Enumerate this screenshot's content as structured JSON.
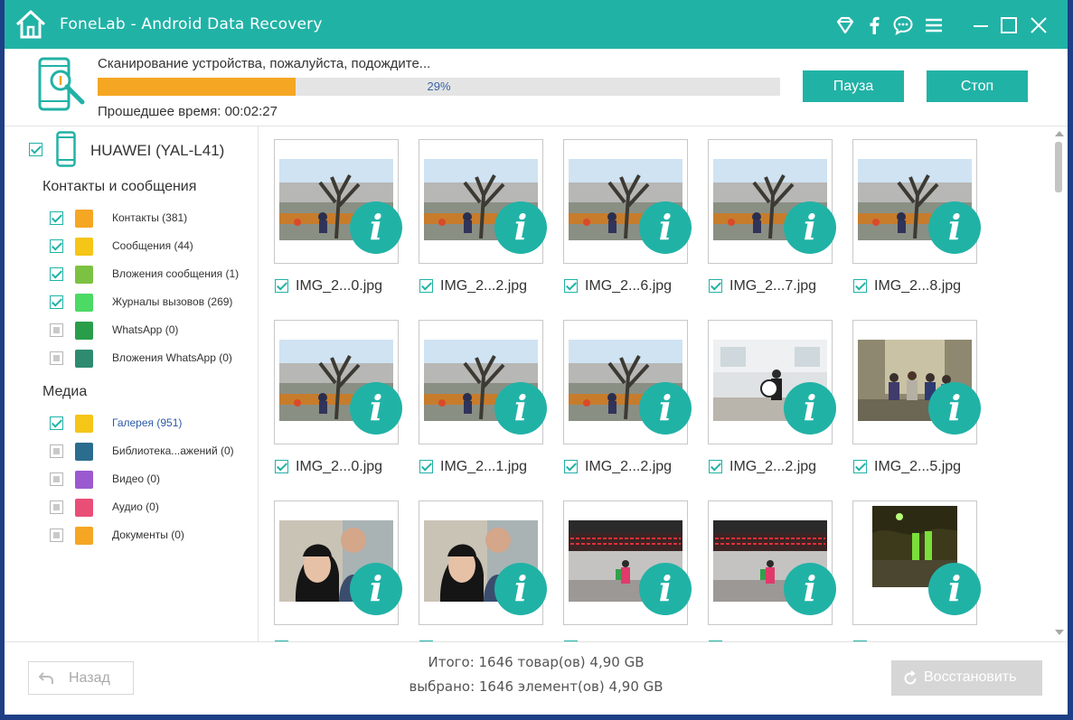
{
  "app": {
    "title": "FoneLab - Android Data Recovery"
  },
  "titlebar_icons": [
    "wifi-diamond-icon",
    "facebook-icon",
    "chat-icon",
    "menu-icon",
    "minimize-icon",
    "maximize-icon",
    "close-icon"
  ],
  "scan": {
    "status": "Сканирование устройства, пожалуйста, подождите...",
    "progress": 29,
    "progress_label": "29%",
    "elapsed_label": "Прошедшее время: 00:02:27",
    "pause_label": "Пауза",
    "stop_label": "Стоп"
  },
  "sidebar": {
    "device": "HUAWEI (YAL-L41)",
    "sections": [
      {
        "title": "Контакты и сообщения",
        "items": [
          {
            "label": "Контакты (381)",
            "checked": true,
            "icon": "contacts-icon",
            "color": "#f5a623"
          },
          {
            "label": "Сообщения (44)",
            "checked": true,
            "icon": "messages-icon",
            "color": "#f5c518"
          },
          {
            "label": "Вложения сообщения (1)",
            "checked": true,
            "icon": "attachment-icon",
            "color": "#7cc242"
          },
          {
            "label": "Журналы вызовов (269)",
            "checked": true,
            "icon": "call-log-icon",
            "color": "#4cd964"
          },
          {
            "label": "WhatsApp (0)",
            "checked": false,
            "icon": "whatsapp-icon",
            "color": "#2a9d4a"
          },
          {
            "label": "Вложения WhatsApp (0)",
            "checked": false,
            "icon": "whatsapp-attachment-icon",
            "color": "#2e8b6f"
          }
        ]
      },
      {
        "title": "Медиа",
        "items": [
          {
            "label": "Галерея (951)",
            "checked": true,
            "icon": "gallery-icon",
            "color": "#f5c518",
            "active": true
          },
          {
            "label": "Библиотека...ажений (0)",
            "checked": false,
            "icon": "image-library-icon",
            "color": "#2b6d8e"
          },
          {
            "label": "Видео (0)",
            "checked": false,
            "icon": "video-icon",
            "color": "#9b59d0"
          },
          {
            "label": "Аудио (0)",
            "checked": false,
            "icon": "audio-icon",
            "color": "#e94e77"
          },
          {
            "label": "Документы (0)",
            "checked": false,
            "icon": "documents-icon",
            "color": "#f5a623"
          }
        ]
      }
    ]
  },
  "grid": {
    "rows": [
      [
        {
          "name": "IMG_2...0.jpg",
          "scene": "park"
        },
        {
          "name": "IMG_2...2.jpg",
          "scene": "park"
        },
        {
          "name": "IMG_2...6.jpg",
          "scene": "park"
        },
        {
          "name": "IMG_2...7.jpg",
          "scene": "park"
        },
        {
          "name": "IMG_2...8.jpg",
          "scene": "park"
        }
      ],
      [
        {
          "name": "IMG_2...0.jpg",
          "scene": "park"
        },
        {
          "name": "IMG_2...1.jpg",
          "scene": "park"
        },
        {
          "name": "IMG_2...2.jpg",
          "scene": "park"
        },
        {
          "name": "IMG_2...2.jpg",
          "scene": "panda"
        },
        {
          "name": "IMG_2...5.jpg",
          "scene": "group"
        }
      ],
      [
        {
          "name": "",
          "scene": "selfie"
        },
        {
          "name": "",
          "scene": "selfie"
        },
        {
          "name": "",
          "scene": "station"
        },
        {
          "name": "",
          "scene": "station"
        },
        {
          "name": "",
          "scene": "night"
        }
      ]
    ]
  },
  "footer": {
    "back_label": "Назад",
    "total_label": "Итого: 1646 товар(ов) 4,90 GB",
    "selected_label": "выбрано: 1646 элемент(ов) 4,90 GB",
    "restore_label": "Восстановить"
  },
  "colors": {
    "accent": "#21b2a6",
    "progress": "#f5a623",
    "taskbar": "#1e3f86"
  }
}
